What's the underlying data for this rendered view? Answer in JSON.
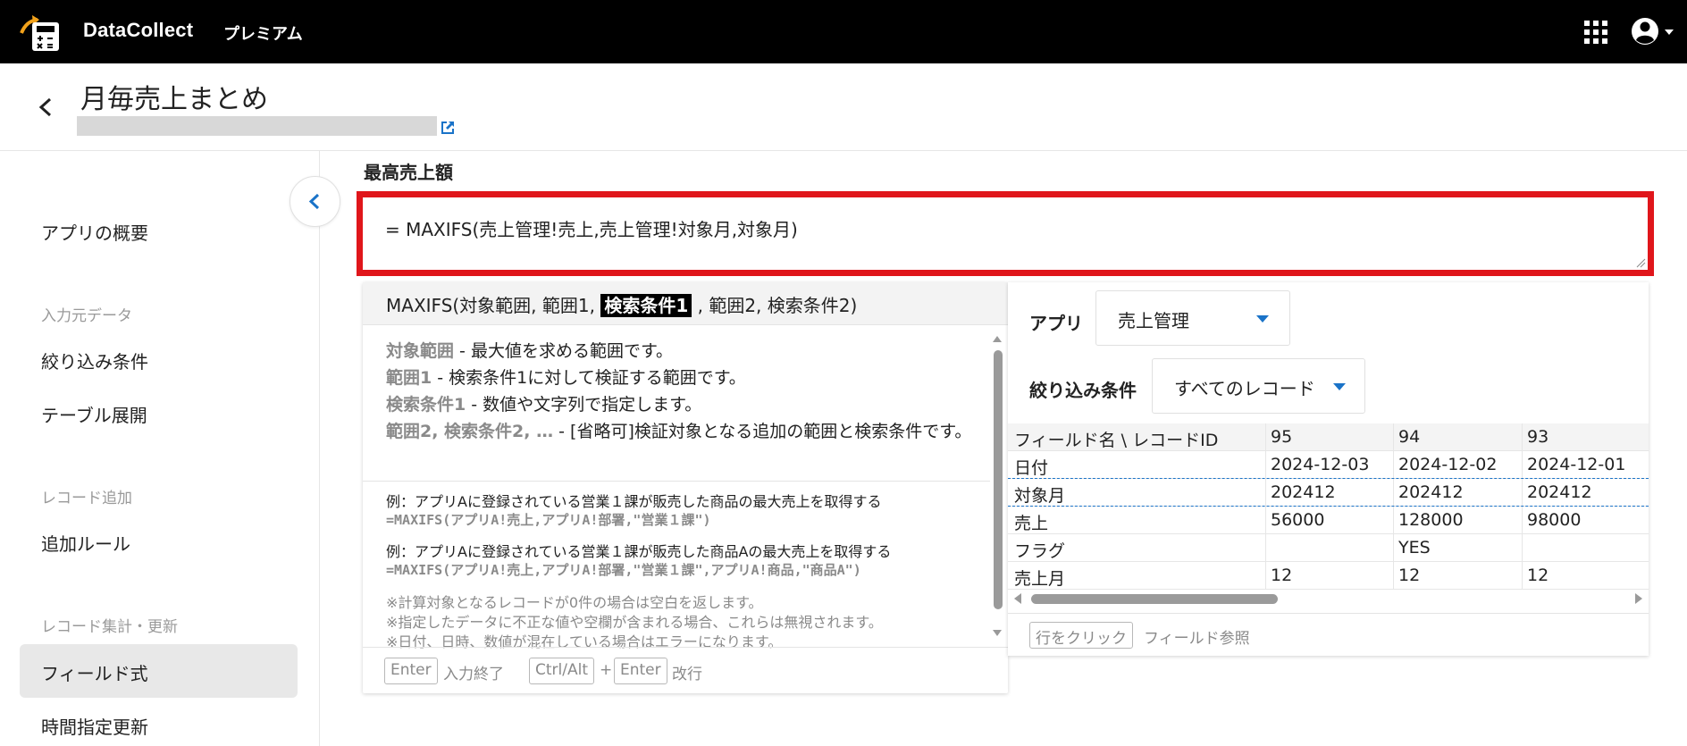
{
  "app": {
    "brand": "DataCollect",
    "plan": "プレミアム"
  },
  "page": {
    "title": "月毎売上まとめ"
  },
  "sidebar": {
    "overview": "アプリの概要",
    "input_head": "入力元データ",
    "filter": "絞り込み条件",
    "table_expand": "テーブル展開",
    "record_add_head": "レコード追加",
    "add_rule": "追加ルール",
    "aggregate_head": "レコード集計・更新",
    "field_formula": "フィールド式",
    "timed_update": "時間指定更新"
  },
  "editor": {
    "field_label": "最高売上額",
    "formula": "= MAXIFS(売上管理!売上,売上管理!対象月,対象月)"
  },
  "help": {
    "sig_pre": "MAXIFS(対象範囲, 範囲1, ",
    "sig_hl": "検索条件1",
    "sig_post": " , 範囲2, 検索条件2)",
    "d1k": "対象範囲",
    "d1": " - 最大値を求める範囲です。",
    "d2k": "範囲1",
    "d2": " - 検索条件1に対して検証する範囲です。",
    "d3k": "検索条件1",
    "d3": " - 数値や文字列で指定します。",
    "d4k": "範囲2, 検索条件2, …",
    "d4": " - [省略可]検証対象となる追加の範囲と検索条件です。",
    "ex1": "例：アプリAに登録されている営業１課が販売した商品の最大売上を取得する",
    "ex1_code": "=MAXIFS(アプリA!売上,アプリA!部署,\"営業１課\")",
    "ex2": "例：アプリAに登録されている営業１課が販売した商品Aの最大売上を取得する",
    "ex2_code": "=MAXIFS(アプリA!売上,アプリA!部署,\"営業１課\",アプリA!商品,\"商品A\")",
    "note1": "※計算対象となるレコードが0件の場合は空白を返します。",
    "note2": "※指定したデータに不正な値や空欄が含まれる場合、これらは無視されます。",
    "note3": "※日付、日時、数値が混在している場合はエラーになります。",
    "key_enter": "Enter",
    "txt_finish": "入力終了",
    "key_ctrl": "Ctrl/Alt",
    "plus": "+",
    "key_enter2": "Enter",
    "txt_newline": "改行"
  },
  "ref": {
    "app_label": "アプリ",
    "app_value": "売上管理",
    "filter_label": "絞り込み条件",
    "filter_value": "すべてのレコード",
    "rows": [
      {
        "name": "フィールド名 \\ レコードID",
        "v1": "95",
        "v2": "94",
        "v3": "93"
      },
      {
        "name": "日付",
        "v1": "2024-12-03",
        "v2": "2024-12-02",
        "v3": "2024-12-01"
      },
      {
        "name": "対象月",
        "v1": "202412",
        "v2": "202412",
        "v3": "202412"
      },
      {
        "name": "売上",
        "v1": "56000",
        "v2": "128000",
        "v3": "98000"
      },
      {
        "name": "フラグ",
        "v1": "",
        "v2": "YES",
        "v3": ""
      },
      {
        "name": "売上月",
        "v1": "12",
        "v2": "12",
        "v3": "12"
      }
    ],
    "hint_key": "行をクリック",
    "hint_text": "フィールド参照"
  }
}
